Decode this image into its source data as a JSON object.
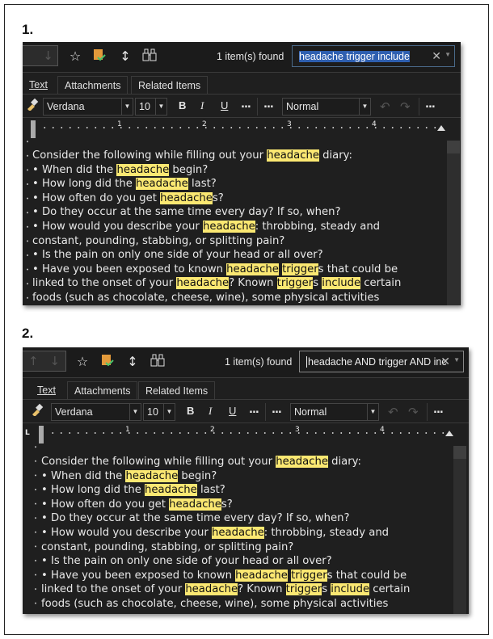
{
  "panels": [
    {
      "step_label": "1.",
      "toolbar": {
        "nav_up_icon": "arrow-up-icon",
        "nav_down_icon": "arrow-down-icon",
        "icons": [
          "star-icon",
          "note-check-icon",
          "expand-collapse-icon",
          "binoculars-icon"
        ],
        "found_text": "1 item(s) found",
        "search_value": "headache trigger include",
        "search_selected": true
      },
      "tabs": [
        {
          "label": "Text",
          "active": true
        },
        {
          "label": "Attachments",
          "active": false
        },
        {
          "label": "Related Items",
          "active": false
        }
      ],
      "format": {
        "font": "Verdana",
        "size": "10",
        "bold": "B",
        "italic": "I",
        "underline": "U",
        "more1": "...",
        "more2": "...",
        "style": "Normal",
        "more3": "..."
      },
      "ruler_numbers": [
        "1",
        "2",
        "3",
        "4"
      ]
    },
    {
      "step_label": "2.",
      "toolbar": {
        "nav_up_icon": "arrow-up-icon",
        "nav_down_icon": "arrow-down-icon",
        "icons": [
          "star-icon",
          "note-check-icon",
          "expand-collapse-icon",
          "binoculars-icon"
        ],
        "found_text": "1 item(s) found",
        "search_value": "headache AND trigger AND inc",
        "search_selected": false
      },
      "tabs": [
        {
          "label": "Text",
          "active": true
        },
        {
          "label": "Attachments",
          "active": false
        },
        {
          "label": "Related Items",
          "active": false
        }
      ],
      "format": {
        "font": "Verdana",
        "size": "10",
        "bold": "B",
        "italic": "I",
        "underline": "U",
        "more1": "...",
        "more2": "...",
        "style": "Normal",
        "more3": "..."
      },
      "ruler_numbers": [
        "1",
        "2",
        "3",
        "4"
      ]
    }
  ],
  "document_lines": [
    [
      {
        "t": "Consider the following while filling out your "
      },
      {
        "t": "headache",
        "h": true
      },
      {
        "t": " diary:"
      }
    ],
    [
      {
        "t": "• When did the "
      },
      {
        "t": "headache",
        "h": true
      },
      {
        "t": " begin?"
      }
    ],
    [
      {
        "t": "• How long did the "
      },
      {
        "t": "headache",
        "h": true
      },
      {
        "t": " last?"
      }
    ],
    [
      {
        "t": "• How often do you get "
      },
      {
        "t": "headache",
        "h": true
      },
      {
        "t": "s?"
      }
    ],
    [
      {
        "t": "• Do they occur at the same time every day? If so, when?"
      }
    ],
    [
      {
        "t": "• How would you describe your "
      },
      {
        "t": "headache",
        "h": true
      },
      {
        "t": ": throbbing, steady and"
      }
    ],
    [
      {
        "t": "constant, pounding, stabbing, or splitting pain?"
      }
    ],
    [
      {
        "t": "• Is the pain on only one side of your head or all over?"
      }
    ],
    [
      {
        "t": "• Have you been exposed to known "
      },
      {
        "t": "headache",
        "h": true
      },
      {
        "t": " "
      },
      {
        "t": "trigger",
        "h": true
      },
      {
        "t": "s that could be"
      }
    ],
    [
      {
        "t": "linked to the onset of your "
      },
      {
        "t": "headache",
        "h": true
      },
      {
        "t": "? Known "
      },
      {
        "t": "trigger",
        "h": true
      },
      {
        "t": "s "
      },
      {
        "t": "include",
        "h": true
      },
      {
        "t": " certain"
      }
    ],
    [
      {
        "t": "foods (such as chocolate, cheese, wine), some physical activities"
      }
    ]
  ],
  "colors": {
    "highlight": "#fbe872",
    "panel_bg": "#1f1f1f",
    "selection": "#2e5fb0"
  }
}
